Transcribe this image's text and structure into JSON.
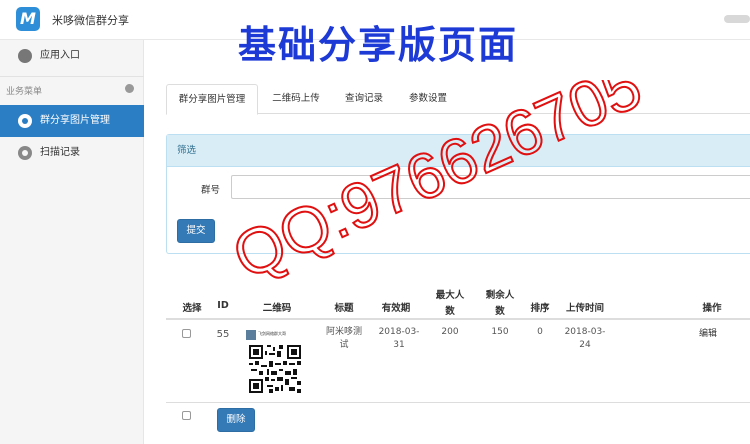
{
  "header": {
    "app_title": "米哆微信群分享",
    "logo_letter": "M",
    "banner": "基础分享版页面"
  },
  "sidebar": {
    "app_entry_label": "应用入口",
    "section_label": "业务菜单",
    "items": [
      {
        "label": "群分享图片管理",
        "active": true
      },
      {
        "label": "扫描记录",
        "active": false
      }
    ]
  },
  "tabs": [
    {
      "label": "群分享图片管理",
      "active": true
    },
    {
      "label": "二维码上传",
      "active": false
    },
    {
      "label": "查询记录",
      "active": false
    },
    {
      "label": "参数设置",
      "active": false
    }
  ],
  "filter": {
    "title": "筛选",
    "group_label": "群号",
    "group_value": "",
    "submit_label": "提交"
  },
  "table": {
    "headers": {
      "select": "选择",
      "id": "ID",
      "qrcode": "二维码",
      "title": "标题",
      "validity": "有效期",
      "max_people_1": "最大人",
      "max_people_2": "数",
      "remaining_1": "剩余人",
      "remaining_2": "数",
      "order": "排序",
      "upload_time": "上传时间",
      "action": "操作"
    },
    "rows": [
      {
        "id": "55",
        "qr_name": "飞剑网络群大哥",
        "title_1": "阿米哆测",
        "title_2": "试",
        "validity_1": "2018-03-",
        "validity_2": "31",
        "max_people": "200",
        "remaining": "150",
        "order": "0",
        "upload_1": "2018-03-",
        "upload_2": "24",
        "action": "编辑"
      }
    ],
    "delete_label": "删除"
  },
  "watermark": {
    "text": "QQ:976626705",
    "color": "#e01010"
  },
  "colors": {
    "accent": "#337ab7",
    "sidebar_active": "#2c7ec4",
    "banner": "#1d39d6",
    "panel_head": "#d9edf7"
  }
}
